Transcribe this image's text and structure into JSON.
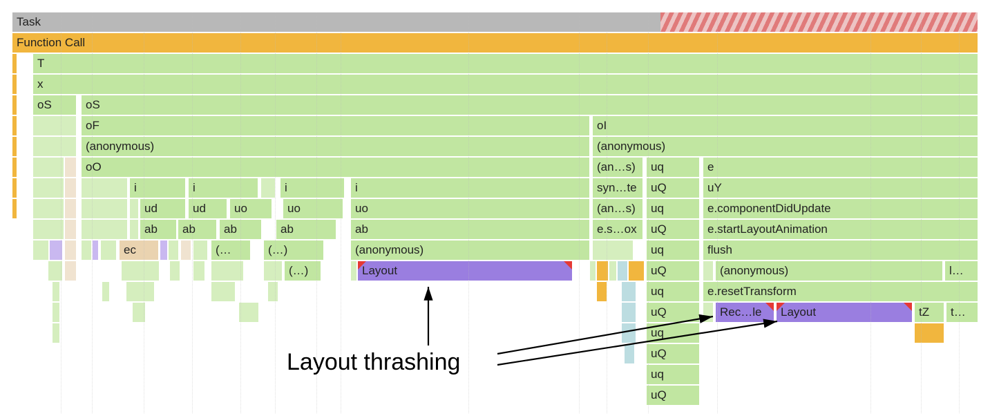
{
  "top": {
    "task": "Task",
    "funcCall": "Function Call"
  },
  "labels": {
    "T": "T",
    "x": "x",
    "oS": "oS",
    "oF": "oF",
    "anon": "(anonymous)",
    "oO": "oO",
    "oI": "oI",
    "i": "i",
    "ud": "ud",
    "uo": "uo",
    "ab": "ab",
    "ec": "ec",
    "paren": "(…",
    "paren2": "(…)",
    "layout": "Layout",
    "anEllipsis": "(an…s)",
    "synEllipsis": "syn…te",
    "esox": "e.s…ox",
    "uq": "uq",
    "uQ": "uQ",
    "e": "e",
    "uY": "uY",
    "compDidUpdate": "e.componentDidUpdate",
    "startLayoutAnim": "e.startLayoutAnimation",
    "flush": "flush",
    "resetTransform": "e.resetTransform",
    "recEllipsis": "Rec…le",
    "tZ": "tZ",
    "tEllipsis": "t…",
    "lEllipsis": "l…"
  },
  "annotation": {
    "text": "Layout thrashing"
  },
  "gridLines": [
    70,
    115,
    190,
    260,
    330,
    380,
    440,
    475,
    660,
    820,
    860,
    920,
    1020,
    1242,
    1315,
    1370
  ]
}
